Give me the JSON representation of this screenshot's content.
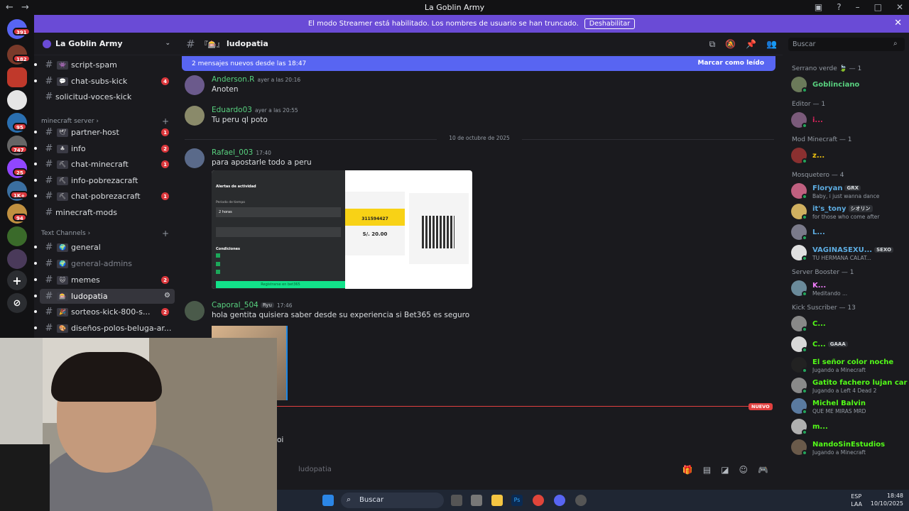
{
  "window": {
    "title": "La Goblin Army"
  },
  "banner": {
    "text": "El modo Streamer está habilitado. Los nombres de usuario se han truncado.",
    "button": "Deshabilitar"
  },
  "guild": {
    "name": "La Goblin Army"
  },
  "server_badges": [
    "391",
    "182",
    "95",
    "747",
    "25",
    "1K+",
    "94"
  ],
  "channels": [
    {
      "emoji": "👾",
      "name": "script-spam"
    },
    {
      "emoji": "💬",
      "name": "chat-subs-kick",
      "count": "4"
    },
    {
      "emoji": "",
      "name": "solicitud-voces-kick"
    },
    {
      "emoji": "🕊",
      "name": "partner-host",
      "count": "1"
    },
    {
      "emoji": "♣",
      "name": "info",
      "count": "2"
    },
    {
      "emoji": "⛏",
      "name": "chat-minecraft",
      "count": "1"
    },
    {
      "emoji": "⛏",
      "name": "info-pobrezacraft"
    },
    {
      "emoji": "⛏",
      "name": "chat-pobrezacraft",
      "count": "1"
    },
    {
      "emoji": "",
      "name": "minecraft-mods"
    },
    {
      "emoji": "🌍",
      "name": "general"
    },
    {
      "emoji": "🌍",
      "name": "general-admins"
    },
    {
      "emoji": "🐱",
      "name": "memes",
      "count": "2"
    },
    {
      "emoji": "🎰",
      "name": "ludopatia"
    },
    {
      "emoji": "🎉",
      "name": "sorteos-kick-800-s...",
      "count": "2"
    },
    {
      "emoji": "🎨",
      "name": "diseños-polos-beluga-ar..."
    }
  ],
  "categories": {
    "minecraft": "minecraft server",
    "text": "Text Channels"
  },
  "chat_header": {
    "channel": "ludopatia"
  },
  "search": {
    "placeholder": "Buscar"
  },
  "new_messages": {
    "text": "2 mensajes nuevos desde las 18:47",
    "mark_read": "Marcar como leído"
  },
  "messages": [
    {
      "user": "Anderson.R",
      "time": "ayer a las 20:16",
      "text": "Anoten"
    },
    {
      "user": "Eduardo03",
      "time": "ayer a las 20:55",
      "text": "Tu peru ql poto"
    },
    {
      "user": "Rafael_003",
      "time": "17:40",
      "text": "para apostarle todo a peru"
    },
    {
      "user": "Caporal_504",
      "tag": "Ryu",
      "time": "17:46",
      "text": "hola gentita quisiera saber desde su experiencia si Bet365 es seguro"
    }
  ],
  "date_divider": "10 de octubre de 2025",
  "attachment": {
    "alert_title": "Alertas de actividad",
    "period_label": "Periodo de tiempo",
    "period_value": "2 horas",
    "ref_code": "311594427",
    "amount": "S/. 20.00",
    "conditions_title": "Condiciones",
    "submit": "Registrarse en bet365"
  },
  "partial_text": "oi",
  "new_label": "NUEVO",
  "composer": {
    "placeholder": "ludopatia"
  },
  "member_groups": [
    {
      "title": "Serrano verde 🍃 — 1",
      "members": [
        {
          "name": "Goblinciano",
          "color": "#58d17f"
        }
      ]
    },
    {
      "title": "Editor — 1",
      "members": [
        {
          "name": "i...",
          "color": "#e0245e"
        }
      ]
    },
    {
      "title": "Mod Minecraft — 1",
      "members": [
        {
          "name": "z...",
          "color": "#f1c40f"
        }
      ]
    },
    {
      "title": "Mosquetero — 4",
      "members": [
        {
          "name": "Floryan",
          "tag": "GRX",
          "activity": "Baby, i just wanna dance",
          "color": "#5dade2"
        },
        {
          "name": "it's_tony",
          "tag": "シオリン",
          "activity": "for those who come after",
          "color": "#5dade2"
        },
        {
          "name": "L...",
          "color": "#5dade2"
        },
        {
          "name": "VAGINASEXU...",
          "tag": "SEXO",
          "activity": "TU HERMANA CALAT...",
          "color": "#5dade2"
        }
      ]
    },
    {
      "title": "Server Booster — 1",
      "members": [
        {
          "name": "K...",
          "activity": "Meditando ...",
          "color": "#f47fff"
        }
      ]
    },
    {
      "title": "Kick Suscriber — 13",
      "members": [
        {
          "name": "C...",
          "color": "#53fc18"
        },
        {
          "name": "C...",
          "tag": "GAAA",
          "color": "#53fc18"
        },
        {
          "name": "El señor color noche",
          "activity": "Jugando a Minecraft",
          "color": "#53fc18"
        },
        {
          "name": "Gatito fachero lujan carri...",
          "activity": "Jugando a Left 4 Dead 2",
          "color": "#53fc18"
        },
        {
          "name": "Michel Balvin",
          "activity": "QUE ME MIRAS MRD",
          "color": "#53fc18"
        },
        {
          "name": "m...",
          "color": "#53fc18"
        },
        {
          "name": "NandoSinEstudios",
          "activity": "Jugando a Minecraft",
          "color": "#53fc18"
        }
      ]
    }
  ],
  "taskbar": {
    "search": "Buscar",
    "lang": "ESP",
    "lang2": "LAA",
    "time": "18:48",
    "date": "10/10/2025"
  },
  "colors": {
    "accent": "#5865f2",
    "banner": "#6a4bd6",
    "badge": "#da373c",
    "online": "#23a55a"
  }
}
